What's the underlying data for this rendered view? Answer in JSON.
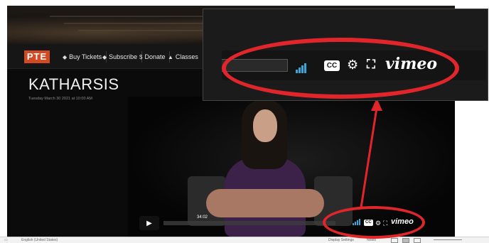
{
  "site": {
    "logo": "PTE",
    "nav": [
      {
        "icon": "◆",
        "label": "Buy Tickets"
      },
      {
        "icon": "◆",
        "label": "Subscribe"
      },
      {
        "icon": "$",
        "label": "Donate"
      },
      {
        "icon": "▲",
        "label": "Classes"
      }
    ],
    "page_title": "KATHARSIS",
    "event_date": "Tuesday March 30 2021 at 10:00 AM"
  },
  "player": {
    "play_icon": "play-icon",
    "time_elapsed": "34:02",
    "controls": [
      "signal-strength-icon",
      "cc-icon",
      "gear-icon",
      "fullscreen-icon"
    ],
    "cc_label": "CC",
    "brand": "vimeo"
  },
  "zoom": {
    "cc_label": "CC",
    "brand": "vimeo",
    "signal_color": "#3aa5d8"
  },
  "statusbar": {
    "language": "English (United States)",
    "display_settings": "Display Settings",
    "notes": "Notes"
  },
  "annotation": {
    "highlight_color": "#e1262b"
  }
}
